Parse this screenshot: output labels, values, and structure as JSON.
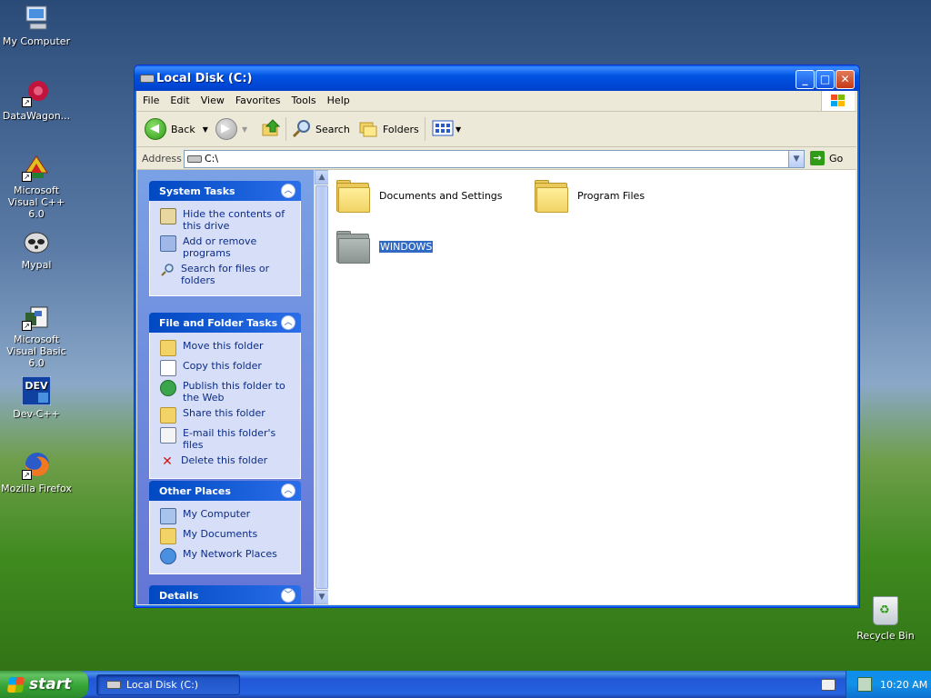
{
  "desktop": {
    "icons": [
      {
        "label": "My Computer",
        "icon": "my-computer-icon"
      },
      {
        "label": "DataWagon...",
        "icon": "datawagon-icon"
      },
      {
        "label": "Microsoft Visual C++ 6.0",
        "icon": "visual-cpp-icon"
      },
      {
        "label": "Mypal",
        "icon": "mypal-icon"
      },
      {
        "label": "Microsoft Visual Basic 6.0",
        "icon": "visual-basic-icon"
      },
      {
        "label": "Dev-C++",
        "icon": "dev-cpp-icon"
      },
      {
        "label": "Mozilla Firefox",
        "icon": "firefox-icon"
      }
    ],
    "recycle_bin": "Recycle Bin"
  },
  "window": {
    "title": "Local Disk (C:)",
    "menu": [
      "File",
      "Edit",
      "View",
      "Favorites",
      "Tools",
      "Help"
    ],
    "toolbar": {
      "back": "Back",
      "search": "Search",
      "folders": "Folders"
    },
    "address": {
      "label": "Address",
      "value": "C:\\",
      "go": "Go"
    }
  },
  "taskpane": {
    "system_tasks": {
      "title": "System Tasks",
      "items": [
        "Hide the contents of this drive",
        "Add or remove programs",
        "Search for files or folders"
      ]
    },
    "file_folder_tasks": {
      "title": "File and Folder Tasks",
      "items": [
        "Move this folder",
        "Copy this folder",
        "Publish this folder to the Web",
        "Share this folder",
        "E-mail this folder's files",
        "Delete this folder"
      ]
    },
    "other_places": {
      "title": "Other Places",
      "items": [
        "My Computer",
        "My Documents",
        "My Network Places"
      ]
    },
    "details": {
      "title": "Details"
    }
  },
  "files": [
    {
      "name": "Documents and Settings",
      "selected": false,
      "hidden": false
    },
    {
      "name": "Program Files",
      "selected": false,
      "hidden": false
    },
    {
      "name": "WINDOWS",
      "selected": true,
      "hidden": true
    }
  ],
  "taskbar": {
    "start": "start",
    "task": "Local Disk (C:)",
    "clock": "10:20 AM"
  },
  "colors": {
    "titlebar": "#0054e3",
    "taskpane": "#7aa1e6",
    "selection": "#316ac5",
    "start": "#37a537"
  }
}
